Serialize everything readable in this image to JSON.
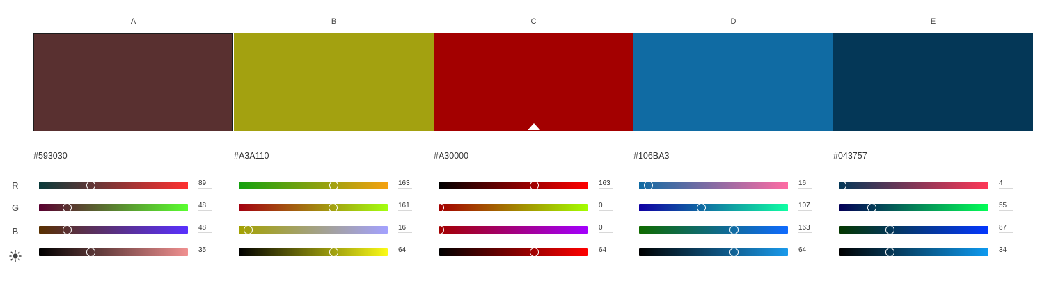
{
  "row_labels": {
    "r": "R",
    "g": "G",
    "b": "B"
  },
  "columns": [
    {
      "letter": "A",
      "hex": "#593030",
      "color": "#593030",
      "selected": true,
      "base": false,
      "sliders": [
        {
          "value": "89",
          "level": 0.349,
          "from": "#0a3a3a",
          "to": "#ff3030"
        },
        {
          "value": "48",
          "level": 0.188,
          "from": "#590030",
          "to": "#59ff30"
        },
        {
          "value": "48",
          "level": 0.188,
          "from": "#593000",
          "to": "#5930ff"
        },
        {
          "value": "35",
          "level": 0.35,
          "from": "#000000",
          "to": "#f09090"
        }
      ]
    },
    {
      "letter": "B",
      "hex": "#A3A110",
      "color": "#A3A110",
      "selected": false,
      "base": false,
      "sliders": [
        {
          "value": "163",
          "level": 0.639,
          "from": "#14a110",
          "to": "#f5a110"
        },
        {
          "value": "161",
          "level": 0.631,
          "from": "#a30010",
          "to": "#a3ff10"
        },
        {
          "value": "16",
          "level": 0.063,
          "from": "#a3a100",
          "to": "#a3a1ff"
        },
        {
          "value": "64",
          "level": 0.64,
          "from": "#000000",
          "to": "#fbfb17"
        }
      ]
    },
    {
      "letter": "C",
      "hex": "#A30000",
      "color": "#A30000",
      "selected": false,
      "base": true,
      "sliders": [
        {
          "value": "163",
          "level": 0.639,
          "from": "#000000",
          "to": "#ff0000"
        },
        {
          "value": "0",
          "level": 0.0,
          "from": "#a30000",
          "to": "#a3ff00"
        },
        {
          "value": "0",
          "level": 0.0,
          "from": "#a30000",
          "to": "#a300ff"
        },
        {
          "value": "64",
          "level": 0.64,
          "from": "#000000",
          "to": "#ff0000"
        }
      ]
    },
    {
      "letter": "D",
      "hex": "#106BA3",
      "color": "#106BA3",
      "selected": false,
      "base": false,
      "sliders": [
        {
          "value": "16",
          "level": 0.063,
          "from": "#106ba3",
          "to": "#ff6ba3"
        },
        {
          "value": "107",
          "level": 0.42,
          "from": "#1000a3",
          "to": "#10ffa3"
        },
        {
          "value": "163",
          "level": 0.639,
          "from": "#106b00",
          "to": "#106bff"
        },
        {
          "value": "64",
          "level": 0.64,
          "from": "#000000",
          "to": "#1a9aeb"
        }
      ]
    },
    {
      "letter": "E",
      "hex": "#043757",
      "color": "#043757",
      "selected": false,
      "base": false,
      "sliders": [
        {
          "value": "4",
          "level": 0.016,
          "from": "#043757",
          "to": "#ff3757"
        },
        {
          "value": "55",
          "level": 0.216,
          "from": "#040057",
          "to": "#04ff57"
        },
        {
          "value": "87",
          "level": 0.341,
          "from": "#043700",
          "to": "#0437ff"
        },
        {
          "value": "34",
          "level": 0.34,
          "from": "#000000",
          "to": "#0e9af0"
        }
      ]
    }
  ]
}
